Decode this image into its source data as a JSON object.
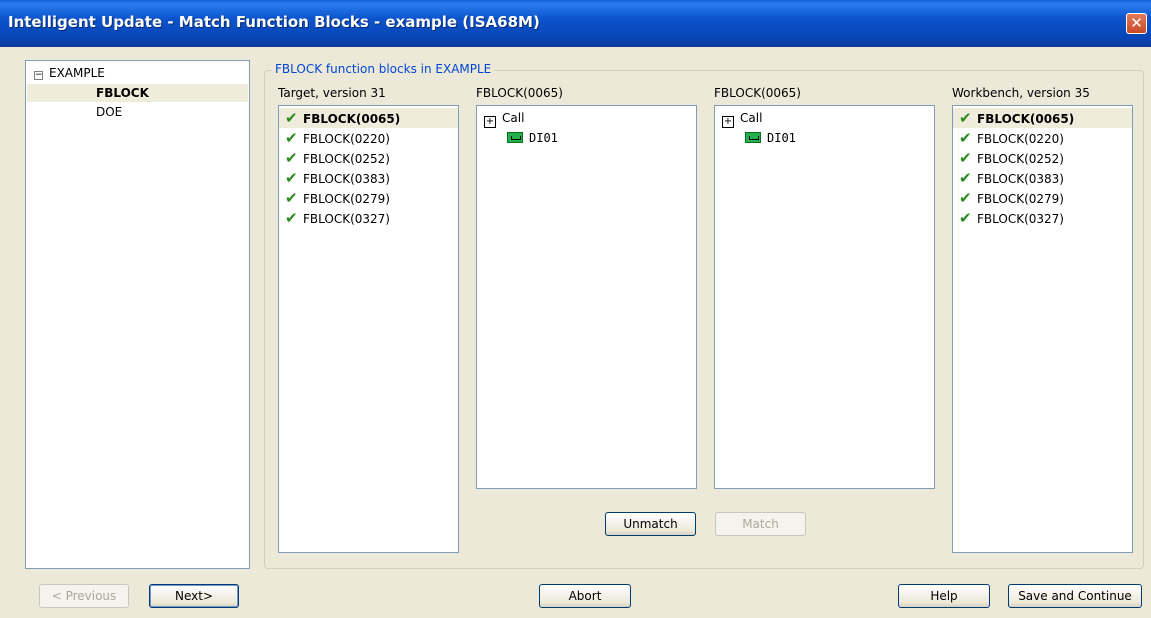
{
  "window": {
    "title": "Intelligent Update - Match Function Blocks - example (ISA68M)",
    "close_label": "✕"
  },
  "tree": {
    "items": [
      {
        "label": "EXAMPLE",
        "expander": "−"
      },
      {
        "label": "FBLOCK"
      },
      {
        "label": "DOE"
      }
    ]
  },
  "group": {
    "title": "FBLOCK function blocks in EXAMPLE"
  },
  "target": {
    "label": "Target, version 31",
    "items": [
      {
        "label": "FBLOCK(0065)"
      },
      {
        "label": "FBLOCK(0220)"
      },
      {
        "label": "FBLOCK(0252)"
      },
      {
        "label": "FBLOCK(0383)"
      },
      {
        "label": "FBLOCK(0279)"
      },
      {
        "label": "FBLOCK(0327)"
      }
    ]
  },
  "detail_left": {
    "label": "FBLOCK(0065)",
    "call_label": "Call",
    "child_label": "DI01"
  },
  "detail_right": {
    "label": "FBLOCK(0065)",
    "call_label": "Call",
    "child_label": "DI01"
  },
  "workbench": {
    "label": "Workbench, version 35",
    "items": [
      {
        "label": "FBLOCK(0065)"
      },
      {
        "label": "FBLOCK(0220)"
      },
      {
        "label": "FBLOCK(0252)"
      },
      {
        "label": "FBLOCK(0383)"
      },
      {
        "label": "FBLOCK(0279)"
      },
      {
        "label": "FBLOCK(0327)"
      }
    ]
  },
  "buttons": {
    "unmatch": "Unmatch",
    "match": "Match",
    "previous": "< Previous",
    "next": "Next>",
    "abort": "Abort",
    "help": "Help",
    "save_continue": "Save and Continue"
  },
  "icons": {
    "check": "✔",
    "call": "+"
  },
  "colors": {
    "titlebar": "#0846b8",
    "check": "#2b8a1e",
    "group_title": "#0046d5",
    "di_icon": "#22b14c"
  }
}
